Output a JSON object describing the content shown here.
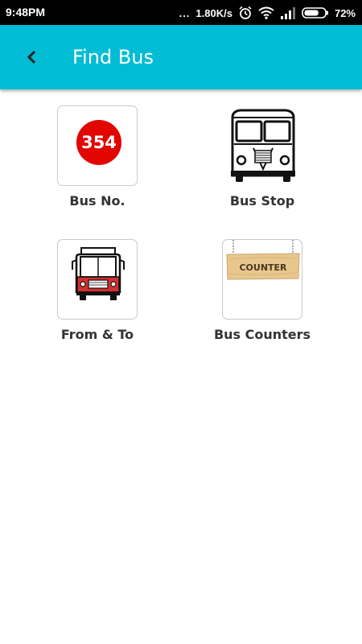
{
  "status_bar": {
    "time": "9:48PM",
    "dots": "...",
    "network_speed": "1.80K/s",
    "battery_percent": "72%",
    "battery_level": 0.72,
    "icons": [
      "alarm-icon",
      "wifi-icon",
      "signal-icon",
      "battery-icon"
    ]
  },
  "app_bar": {
    "title": "Find Bus",
    "back_icon": "chevron-left-icon",
    "background_color": "#00bcd4"
  },
  "tiles": [
    {
      "label": "Bus No.",
      "icon": "bus-number-icon",
      "badge_text": "354",
      "badge_color": "#e10600"
    },
    {
      "label": "Bus Stop",
      "icon": "bus-front-icon"
    },
    {
      "label": "From & To",
      "icon": "red-bus-icon",
      "accent_color": "#d32f2f"
    },
    {
      "label": "Bus Counters",
      "icon": "counter-sign-icon",
      "sign_text": "COUNTER"
    }
  ]
}
